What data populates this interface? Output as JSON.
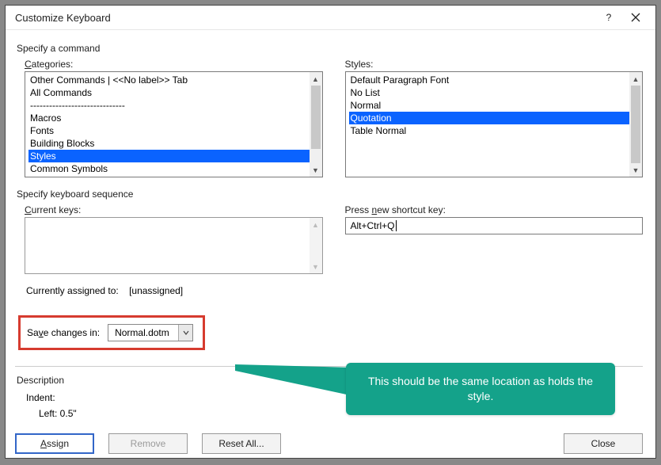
{
  "title": "Customize Keyboard",
  "section_command": "Specify a command",
  "categories": {
    "label_pre": "C",
    "label_post": "ategories:",
    "items": [
      "Other Commands | <<No label>> Tab",
      "All Commands",
      "------------------------------",
      "Macros",
      "Fonts",
      "Building Blocks",
      "Styles",
      "Common Symbols"
    ],
    "selected_index": 6
  },
  "styles": {
    "label": "Styles:",
    "items": [
      "Default Paragraph Font",
      "No List",
      "Normal",
      "Quotation",
      "Table Normal"
    ],
    "selected_index": 3
  },
  "section_sequence": "Specify keyboard sequence",
  "current_keys": {
    "label_pre": "C",
    "label_post": "urrent keys:"
  },
  "press_new": {
    "label_pre": "Press ",
    "label_u": "n",
    "label_post": "ew shortcut key:",
    "value": "Alt+Ctrl+Q"
  },
  "assigned": {
    "label": "Currently assigned to:",
    "value": "[unassigned]"
  },
  "save_changes": {
    "label_pre": "Sa",
    "label_u": "v",
    "label_post": "e changes in:",
    "value": "Normal.dotm"
  },
  "description": {
    "heading": "Description",
    "line1": "Indent:",
    "line2": "Left:  0.5\""
  },
  "buttons": {
    "assign_u": "A",
    "assign_post": "ssign",
    "remove": "Remove",
    "reset": "Reset All...",
    "close": "Close"
  },
  "callout": {
    "text": "This should be the same location as holds the style."
  }
}
